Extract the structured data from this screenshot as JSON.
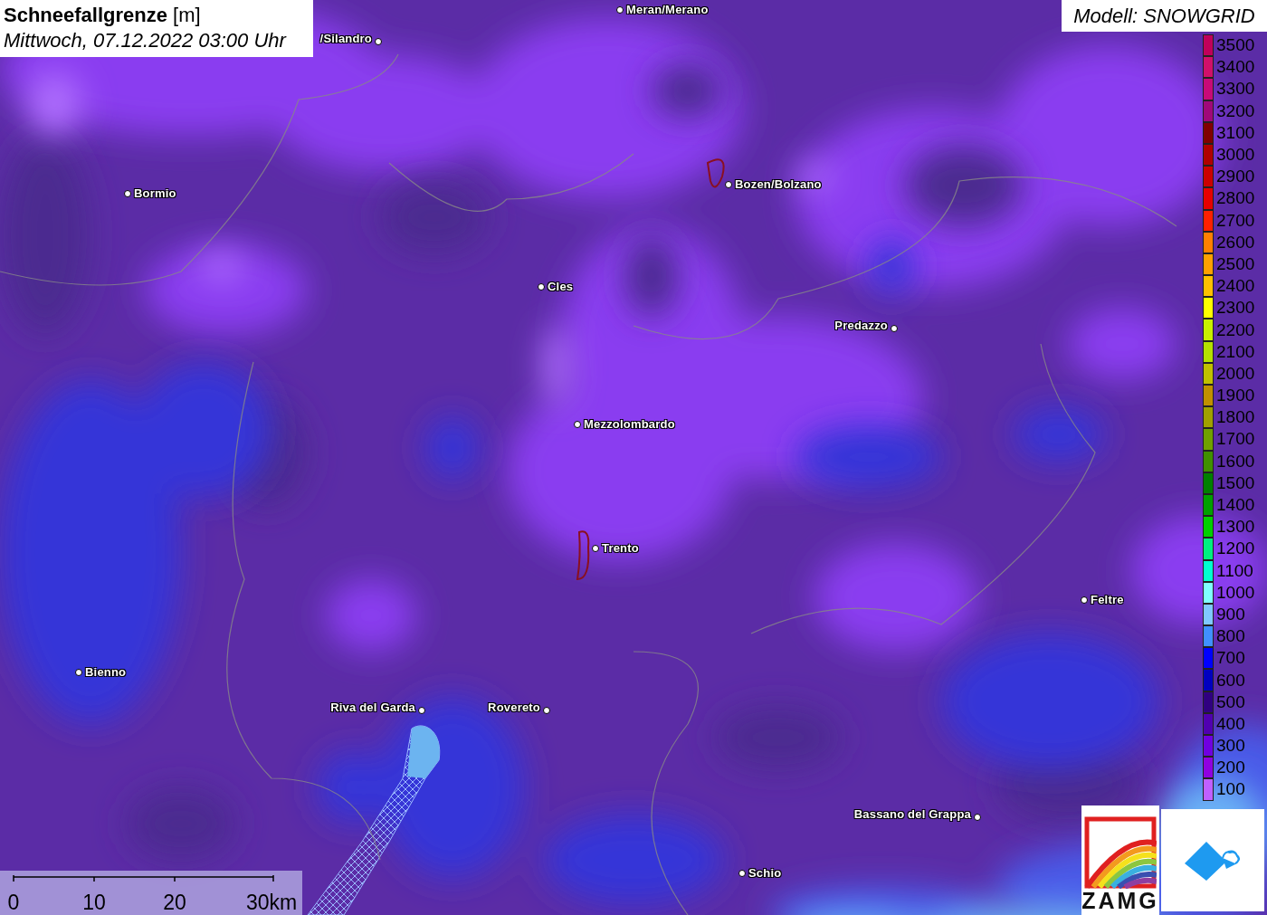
{
  "title": {
    "parameter": "Schneefallgrenze",
    "unit": "[m]",
    "datetime": "Mittwoch, 07.12.2022 03:00 Uhr"
  },
  "model": "Modell: SNOWGRID",
  "legend": [
    {
      "label": "3500",
      "color": "#c0005a"
    },
    {
      "label": "3400",
      "color": "#d0106a"
    },
    {
      "label": "3300",
      "color": "#c80a78"
    },
    {
      "label": "3200",
      "color": "#a0087a"
    },
    {
      "label": "3100",
      "color": "#800000"
    },
    {
      "label": "3000",
      "color": "#b00000"
    },
    {
      "label": "2900",
      "color": "#cc0000"
    },
    {
      "label": "2800",
      "color": "#e60000"
    },
    {
      "label": "2700",
      "color": "#ff2000"
    },
    {
      "label": "2600",
      "color": "#ff8000"
    },
    {
      "label": "2500",
      "color": "#ffa000"
    },
    {
      "label": "2400",
      "color": "#ffc000"
    },
    {
      "label": "2300",
      "color": "#ffff00"
    },
    {
      "label": "2200",
      "color": "#c8f000"
    },
    {
      "label": "2100",
      "color": "#b4e000"
    },
    {
      "label": "2000",
      "color": "#c0c000"
    },
    {
      "label": "1900",
      "color": "#c09000"
    },
    {
      "label": "1800",
      "color": "#a0a000"
    },
    {
      "label": "1700",
      "color": "#70a000"
    },
    {
      "label": "1600",
      "color": "#409000"
    },
    {
      "label": "1500",
      "color": "#008000"
    },
    {
      "label": "1400",
      "color": "#00a000"
    },
    {
      "label": "1300",
      "color": "#00d000"
    },
    {
      "label": "1200",
      "color": "#00f080"
    },
    {
      "label": "1100",
      "color": "#00ffd0"
    },
    {
      "label": "1000",
      "color": "#80ffff"
    },
    {
      "label": "900",
      "color": "#80c8ff"
    },
    {
      "label": "800",
      "color": "#4090ff"
    },
    {
      "label": "700",
      "color": "#0000ff"
    },
    {
      "label": "600",
      "color": "#0000c0"
    },
    {
      "label": "500",
      "color": "#300080"
    },
    {
      "label": "400",
      "color": "#5000b0"
    },
    {
      "label": "300",
      "color": "#7000e0"
    },
    {
      "label": "200",
      "color": "#9000e0"
    },
    {
      "label": "100",
      "color": "#c060ff"
    }
  ],
  "cities": [
    {
      "name": "Meran/Merano"
    },
    {
      "name": "/Silandro"
    },
    {
      "name": "Bormio"
    },
    {
      "name": "Bozen/Bolzano"
    },
    {
      "name": "Cles"
    },
    {
      "name": "Predazzo"
    },
    {
      "name": "Mezzolombardo"
    },
    {
      "name": "Trento"
    },
    {
      "name": "Feltre"
    },
    {
      "name": "Bienno"
    },
    {
      "name": "Riva del Garda"
    },
    {
      "name": "Rovereto"
    },
    {
      "name": "Bassano del Grappa"
    },
    {
      "name": "Schio"
    }
  ],
  "scale": {
    "ticks": [
      "0",
      "10",
      "20",
      "30km"
    ]
  },
  "logos": {
    "zamg": "ZAMG"
  }
}
